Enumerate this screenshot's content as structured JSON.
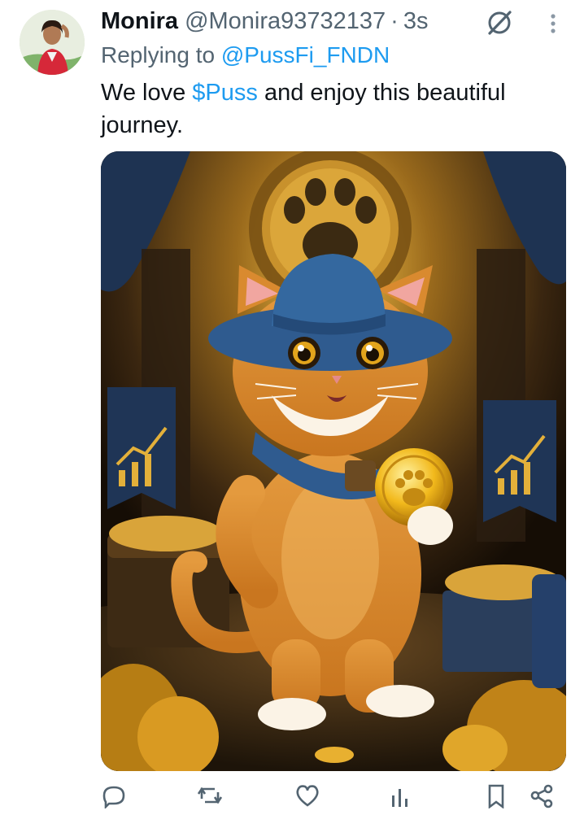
{
  "tweet": {
    "display_name": "Monira",
    "handle": "@Monira93732137",
    "separator": "·",
    "time": "3s",
    "replying_prefix": "Replying to",
    "replying_to": "@PussFi_FNDN",
    "text_before": "We love ",
    "cashtag": "$Puss",
    "text_after": " and enjoy this beautiful journey."
  },
  "icons": {
    "grok": "grok-icon",
    "more": "more-dots-icon",
    "reply": "reply-icon",
    "retweet": "retweet-icon",
    "like": "heart-icon",
    "views": "views-icon",
    "bookmark": "bookmark-icon",
    "share": "share-icon"
  },
  "colors": {
    "link": "#1d9bf0",
    "secondary_text": "#536471",
    "primary_text": "#0f1419"
  }
}
